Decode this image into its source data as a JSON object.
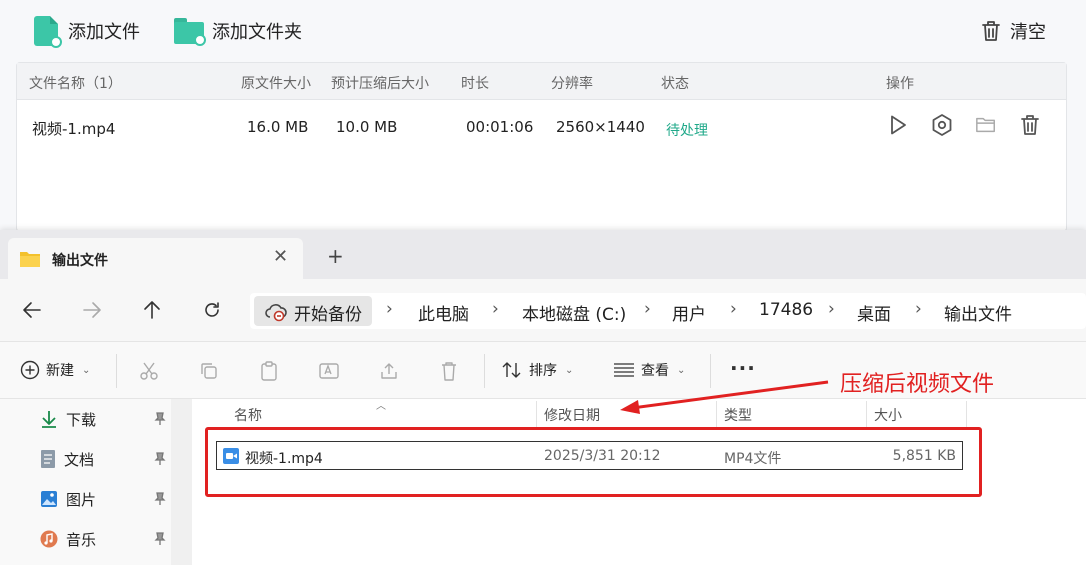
{
  "app": {
    "toolbar": {
      "add_file": "添加文件",
      "add_folder": "添加文件夹",
      "clear": "清空"
    },
    "table": {
      "headers": {
        "name": "文件名称（1）",
        "original_size": "原文件大小",
        "estimated_size": "预计压缩后大小",
        "duration": "时长",
        "resolution": "分辨率",
        "status": "状态",
        "actions": "操作"
      },
      "rows": [
        {
          "name": "视频-1.mp4",
          "original_size": "16.0 MB",
          "estimated_size": "10.0 MB",
          "duration": "00:01:06",
          "resolution": "2560×1440",
          "status": "待处理"
        }
      ]
    },
    "colors": {
      "accent": "#3cc6a7",
      "status_pending": "#20a98a"
    }
  },
  "explorer": {
    "tab_title": "输出文件",
    "breadcrumb": {
      "backup": "开始备份",
      "items": [
        "此电脑",
        "本地磁盘 (C:)",
        "用户",
        "17486",
        "桌面",
        "输出文件"
      ]
    },
    "commands": {
      "new": "新建",
      "sort": "排序",
      "view": "查看",
      "more": "···"
    },
    "nav_items": [
      "下载",
      "文档",
      "图片",
      "音乐"
    ],
    "columns": {
      "name": "名称",
      "modified": "修改日期",
      "type": "类型",
      "size": "大小"
    },
    "files": [
      {
        "name": "视频-1.mp4",
        "modified": "2025/3/31 20:12",
        "type": "MP4文件",
        "size": "5,851 KB"
      }
    ]
  },
  "annotation": {
    "label": "压缩后视频文件",
    "color": "#e12121"
  }
}
